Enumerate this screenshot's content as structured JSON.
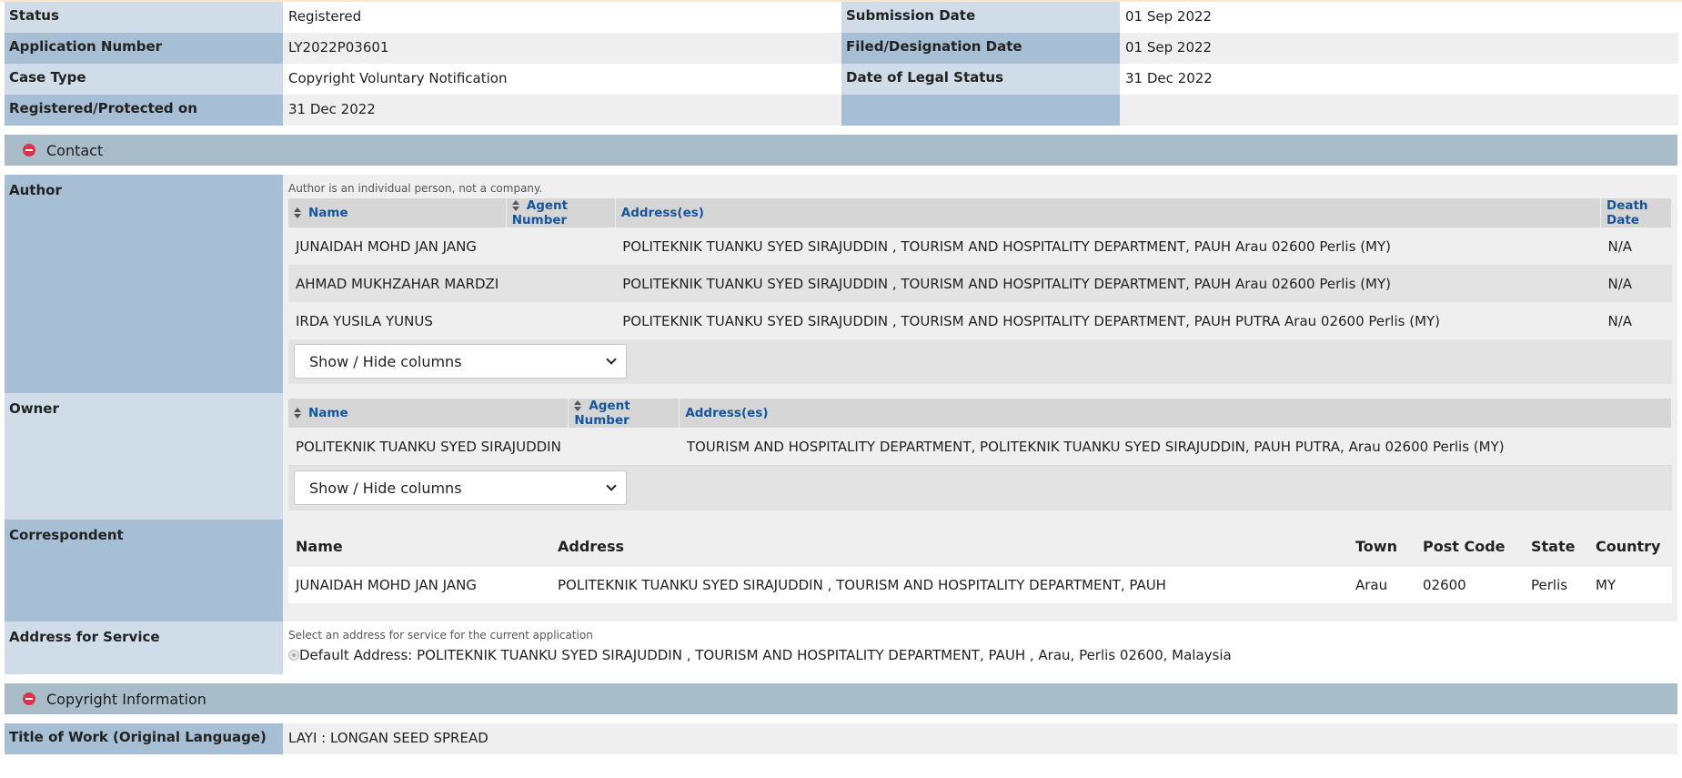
{
  "summary": {
    "rows": [
      {
        "l1": "Status",
        "v1": "Registered",
        "l2": "Submission Date",
        "v2": "01 Sep 2022"
      },
      {
        "l1": "Application Number",
        "v1": "LY2022P03601",
        "l2": "Filed/Designation Date",
        "v2": "01 Sep 2022"
      },
      {
        "l1": "Case Type",
        "v1": "Copyright Voluntary Notification",
        "l2": "Date of Legal Status",
        "v2": "31 Dec 2022"
      },
      {
        "l1": "Registered/Protected on",
        "v1": "31 Dec 2022",
        "l2": "",
        "v2": ""
      }
    ]
  },
  "contact": {
    "section_title": "Contact",
    "author": {
      "label": "Author",
      "hint": "Author is an individual person, not a company.",
      "headers": [
        "Name",
        "Agent Number",
        "Address(es)",
        "Death Date"
      ],
      "rows": [
        {
          "name": "JUNAIDAH MOHD JAN JANG",
          "agent": "",
          "address": "POLITEKNIK TUANKU SYED SIRAJUDDIN , TOURISM AND HOSPITALITY DEPARTMENT, PAUH Arau 02600 Perlis (MY)",
          "death": "N/A"
        },
        {
          "name": "AHMAD MUKHZAHAR MARDZI",
          "agent": "",
          "address": "POLITEKNIK TUANKU SYED SIRAJUDDIN , TOURISM AND HOSPITALITY DEPARTMENT, PAUH Arau 02600 Perlis (MY)",
          "death": "N/A"
        },
        {
          "name": "IRDA YUSILA YUNUS",
          "agent": "",
          "address": "POLITEKNIK TUANKU SYED SIRAJUDDIN , TOURISM AND HOSPITALITY DEPARTMENT, PAUH PUTRA Arau 02600 Perlis (MY)",
          "death": "N/A"
        }
      ],
      "columns_select": "Show / Hide columns"
    },
    "owner": {
      "label": "Owner",
      "headers": [
        "Name",
        "Agent Number",
        "Address(es)"
      ],
      "rows": [
        {
          "name": "POLITEKNIK TUANKU SYED SIRAJUDDIN",
          "agent": "",
          "address": "TOURISM AND HOSPITALITY DEPARTMENT, POLITEKNIK TUANKU SYED SIRAJUDDIN, PAUH PUTRA, Arau 02600 Perlis (MY)"
        }
      ],
      "columns_select": "Show / Hide columns"
    },
    "correspondent": {
      "label": "Correspondent",
      "headers": [
        "Name",
        "Address",
        "Town",
        "Post Code",
        "State",
        "Country"
      ],
      "row": {
        "name": "JUNAIDAH MOHD JAN JANG",
        "address": "POLITEKNIK TUANKU SYED SIRAJUDDIN , TOURISM AND HOSPITALITY DEPARTMENT, PAUH",
        "town": "Arau",
        "postcode": "02600",
        "state": "Perlis",
        "country": "MY"
      }
    },
    "service": {
      "label": "Address for Service",
      "hint": "Select an address for service for the current application",
      "default_address": "Default Address: POLITEKNIK TUANKU SYED SIRAJUDDIN , TOURISM AND HOSPITALITY DEPARTMENT, PAUH , Arau, Perlis 02600, Malaysia"
    }
  },
  "copyright": {
    "section_title": "Copyright Information",
    "title_label": "Title of Work (Original Language)",
    "title_value": "LAYI : LONGAN SEED SPREAD"
  },
  "colors": {
    "section_bg": "#a9bcc9",
    "label_dark": "#a7bfd4",
    "label_light": "#d0dde8",
    "link_blue": "#17559b",
    "minus_red": "#d9354a"
  },
  "icons": {
    "section_toggle": "minus-circle-icon",
    "sort": "sort-icon",
    "dropdown": "chevron-down-icon"
  }
}
